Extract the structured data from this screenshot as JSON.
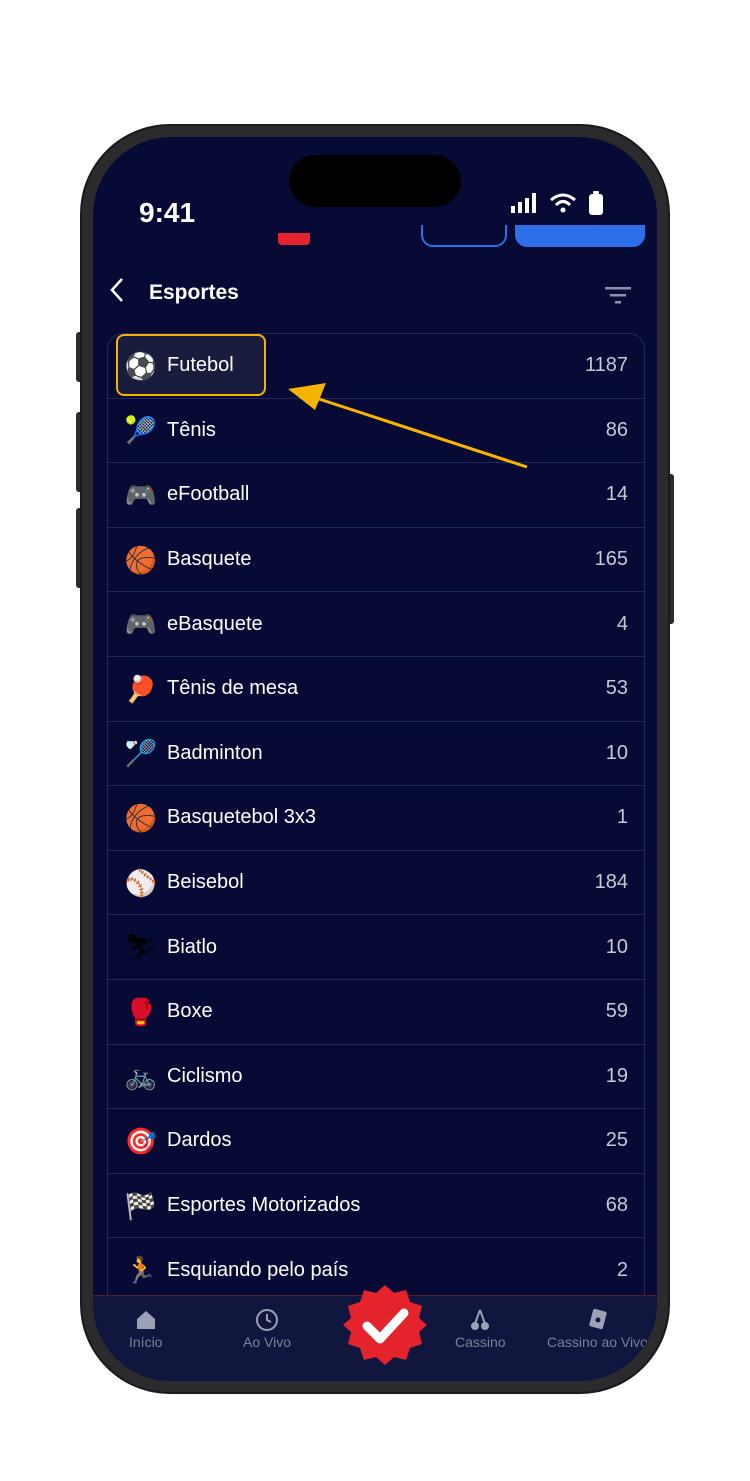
{
  "status_bar": {
    "time": "9:41"
  },
  "header": {
    "title": "Esportes",
    "back_icon": "chevron-left-icon",
    "filter_icon": "filter-icon"
  },
  "sports": [
    {
      "name": "Futebol",
      "count": "1187",
      "icon": "⚽"
    },
    {
      "name": "Tênis",
      "count": "86",
      "icon": "🎾"
    },
    {
      "name": "eFootball",
      "count": "14",
      "icon": "🎮"
    },
    {
      "name": "Basquete",
      "count": "165",
      "icon": "🏀"
    },
    {
      "name": "eBasquete",
      "count": "4",
      "icon": "🎮"
    },
    {
      "name": "Tênis de mesa",
      "count": "53",
      "icon": "🏓"
    },
    {
      "name": "Badminton",
      "count": "10",
      "icon": "🏸"
    },
    {
      "name": "Basquetebol 3x3",
      "count": "1",
      "icon": "🏀"
    },
    {
      "name": "Beisebol",
      "count": "184",
      "icon": "⚾"
    },
    {
      "name": "Biatlo",
      "count": "10",
      "icon": "⛷"
    },
    {
      "name": "Boxe",
      "count": "59",
      "icon": "🥊"
    },
    {
      "name": "Ciclismo",
      "count": "19",
      "icon": "🚲"
    },
    {
      "name": "Dardos",
      "count": "25",
      "icon": "🎯"
    },
    {
      "name": "Esportes Motorizados",
      "count": "68",
      "icon": "🏁"
    },
    {
      "name": "Esquiando pelo país",
      "count": "2",
      "icon": "🏃"
    }
  ],
  "bottom_nav": {
    "home": "Início",
    "live": "Ao Vivo",
    "casino": "Cassino",
    "live_casino": "Cassino ao Vivo"
  },
  "colors": {
    "background": "#060a34",
    "accent": "#f6b400",
    "badge": "#e5232d"
  }
}
